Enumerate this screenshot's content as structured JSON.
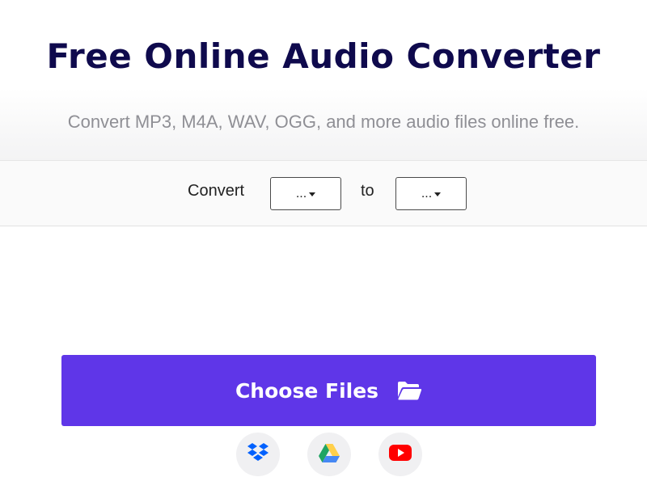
{
  "header": {
    "title": "Free Online Audio Converter",
    "subtitle": "Convert MP3, M4A, WAV, OGG, and more audio files online free."
  },
  "converter": {
    "convert_label": "Convert",
    "to_label": "to",
    "from_value": "...",
    "to_value": "..."
  },
  "upload": {
    "choose_label": "Choose Files",
    "icon": "folder-open-icon"
  },
  "sources": [
    {
      "name": "dropbox-icon",
      "color": "#0061fe"
    },
    {
      "name": "google-drive-icon",
      "colors": [
        "#1fa463",
        "#ffd04b",
        "#4688f4"
      ]
    },
    {
      "name": "youtube-icon",
      "color": "#ff0000"
    }
  ],
  "colors": {
    "title": "#0f0a4d",
    "subtitle": "#8f8f95",
    "accent": "#5f36e8"
  }
}
